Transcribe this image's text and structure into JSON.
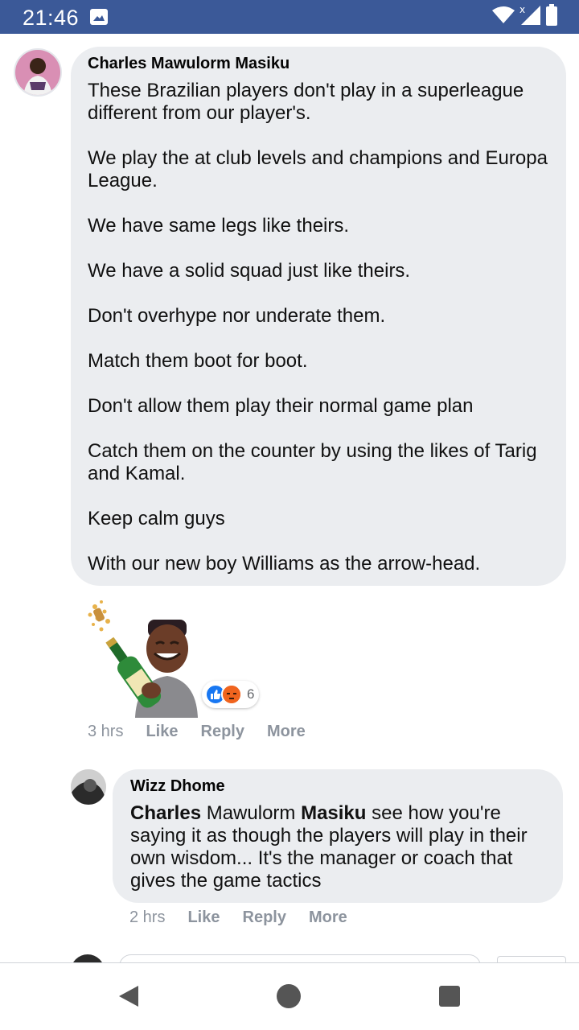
{
  "status_bar": {
    "time": "21:46",
    "icons": [
      "gallery-icon",
      "wifi-icon",
      "signal-icon",
      "battery-icon"
    ]
  },
  "comment": {
    "author": "Charles Mawulorm Masiku",
    "paragraphs": [
      "These Brazilian players don't play in a superleague different from our player's.",
      "We play the at club levels and champions and Europa League.",
      "We have same legs like theirs.",
      "We have a solid squad just like theirs.",
      "Don't overhype nor underate them.",
      "Match them boot for boot.",
      "Don't allow them play their normal game plan",
      "Catch them on the counter by using the likes of Tarig and Kamal.",
      "Keep calm guys",
      "With our new boy Williams as the arrow-head."
    ],
    "sticker": "champagne-avatar-sticker",
    "reactions": {
      "types": [
        "like",
        "angry"
      ],
      "count": "6"
    },
    "time": "3 hrs",
    "like_label": "Like",
    "reply_label": "Reply",
    "more_label": "More"
  },
  "reply": {
    "author": "Wizz Dhome",
    "mention_first": "Charles",
    "mention_middle": " Mawulorm ",
    "mention_last": "Masiku",
    "text": " see how you're saying it as though the players will play in their own wisdom... It's the manager or coach that gives the game tactics",
    "time": "2 hrs",
    "like_label": "Like",
    "reply_label": "Reply",
    "more_label": "More"
  },
  "colors": {
    "status_bar": "#3b5998",
    "bubble": "#ebedf0",
    "action_text": "#8d949e",
    "like_blue": "#1877f2",
    "angry_orange": "#f0641e"
  }
}
